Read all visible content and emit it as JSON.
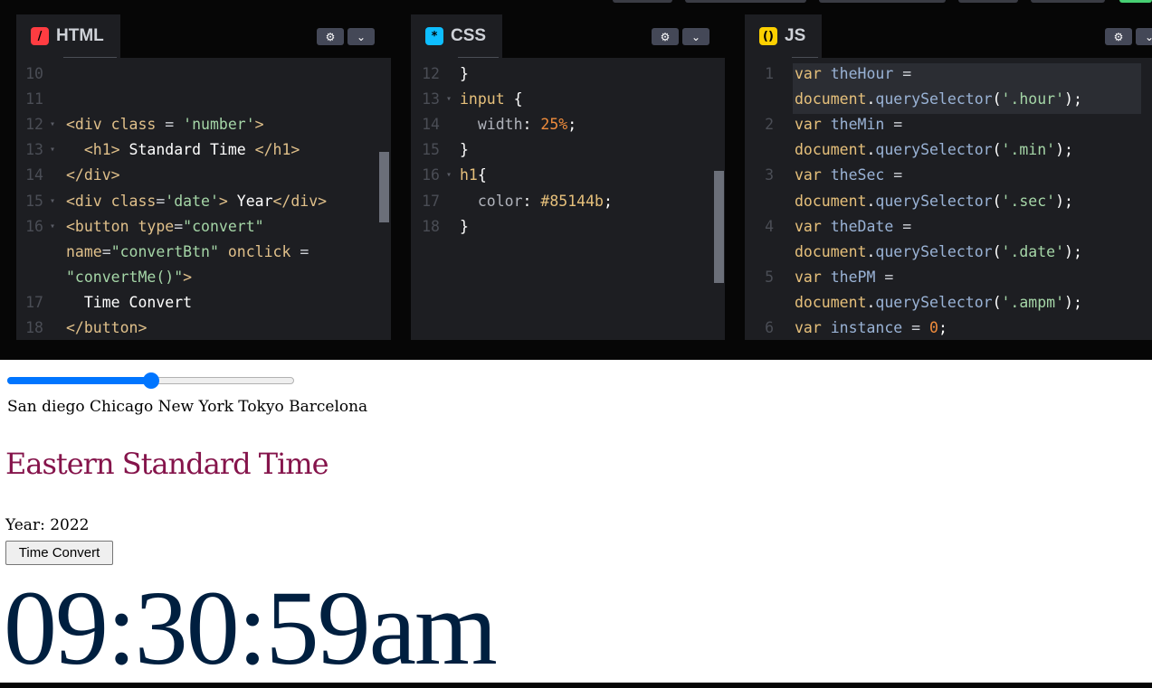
{
  "editors": {
    "html": {
      "title": "HTML",
      "badge": "/",
      "badge_color": "#ff3c41",
      "lines": [
        {
          "n": "10",
          "segs": []
        },
        {
          "n": "11",
          "segs": []
        },
        {
          "n": "12",
          "fold": true,
          "segs": [
            [
              "k-tag",
              "<div "
            ],
            [
              "k-attr",
              "class"
            ],
            [
              "k-op",
              " = "
            ],
            [
              "k-str",
              "'number'"
            ],
            [
              "k-tag",
              ">"
            ]
          ]
        },
        {
          "n": "13",
          "fold": true,
          "segs": [
            [
              "k-op",
              "  "
            ],
            [
              "k-tag",
              "<h1>"
            ],
            [
              "k-white",
              " Standard Time "
            ],
            [
              "k-tag",
              "</h1>"
            ]
          ]
        },
        {
          "n": "14",
          "segs": [
            [
              "k-tag",
              "</div>"
            ]
          ]
        },
        {
          "n": "15",
          "fold": true,
          "segs": [
            [
              "k-tag",
              "<div "
            ],
            [
              "k-attr",
              "class"
            ],
            [
              "k-op",
              "="
            ],
            [
              "k-str",
              "'date'"
            ],
            [
              "k-tag",
              ">"
            ],
            [
              "k-white",
              " Year"
            ],
            [
              "k-tag",
              "</div>"
            ]
          ]
        },
        {
          "n": "16",
          "fold": true,
          "segs": [
            [
              "k-tag",
              "<button "
            ],
            [
              "k-attr",
              "type"
            ],
            [
              "k-op",
              "="
            ],
            [
              "k-str",
              "\"convert\""
            ]
          ]
        },
        {
          "n": "",
          "segs": [
            [
              "k-attr",
              "name"
            ],
            [
              "k-op",
              "="
            ],
            [
              "k-str",
              "\"convertBtn\""
            ],
            [
              "k-op",
              " "
            ],
            [
              "k-attr",
              "onclick"
            ],
            [
              "k-op",
              " ="
            ]
          ]
        },
        {
          "n": "",
          "segs": [
            [
              "k-str",
              "\"convertMe()\""
            ],
            [
              "k-tag",
              ">"
            ]
          ]
        },
        {
          "n": "17",
          "segs": [
            [
              "k-white",
              "  Time Convert"
            ]
          ]
        },
        {
          "n": "18",
          "segs": [
            [
              "k-tag",
              "</button>"
            ]
          ]
        }
      ]
    },
    "css": {
      "title": "CSS",
      "badge": "*",
      "badge_color": "#0ebeff",
      "lines": [
        {
          "n": "12",
          "segs": [
            [
              "k-white",
              "}"
            ]
          ]
        },
        {
          "n": "13",
          "fold": true,
          "segs": [
            [
              "k-kw",
              "input"
            ],
            [
              "k-white",
              " {"
            ]
          ]
        },
        {
          "n": "14",
          "segs": [
            [
              "k-op",
              "  "
            ],
            [
              "k-prop",
              "width"
            ],
            [
              "k-white",
              ": "
            ],
            [
              "k-num",
              "25%"
            ],
            [
              "k-white",
              ";"
            ]
          ]
        },
        {
          "n": "15",
          "segs": [
            [
              "k-white",
              "}"
            ]
          ]
        },
        {
          "n": "16",
          "fold": true,
          "segs": [
            [
              "k-kw",
              "h1"
            ],
            [
              "k-white",
              "{"
            ]
          ]
        },
        {
          "n": "17",
          "segs": [
            [
              "k-op",
              "  "
            ],
            [
              "k-prop",
              "color"
            ],
            [
              "k-white",
              ": "
            ],
            [
              "k-kw",
              "#85144b"
            ],
            [
              "k-white",
              ";"
            ]
          ]
        },
        {
          "n": "18",
          "segs": [
            [
              "k-white",
              "}"
            ]
          ]
        }
      ]
    },
    "js": {
      "title": "JS",
      "badge": "()",
      "badge_color": "#fcd000",
      "lines": [
        {
          "n": "1",
          "segs": [
            [
              "k-kw",
              "var "
            ],
            [
              "k-var",
              "theHour"
            ],
            [
              "k-op",
              " ="
            ]
          ]
        },
        {
          "n": "",
          "segs": [
            [
              "k-kw",
              "document"
            ],
            [
              "k-white",
              "."
            ],
            [
              "k-fn",
              "querySelector"
            ],
            [
              "k-white",
              "("
            ],
            [
              "k-str",
              "'.hour'"
            ],
            [
              "k-white",
              ");"
            ]
          ]
        },
        {
          "n": "2",
          "segs": [
            [
              "k-kw",
              "var "
            ],
            [
              "k-var",
              "theMin"
            ],
            [
              "k-op",
              " ="
            ]
          ]
        },
        {
          "n": "",
          "segs": [
            [
              "k-kw",
              "document"
            ],
            [
              "k-white",
              "."
            ],
            [
              "k-fn",
              "querySelector"
            ],
            [
              "k-white",
              "("
            ],
            [
              "k-str",
              "'.min'"
            ],
            [
              "k-white",
              ");"
            ]
          ]
        },
        {
          "n": "3",
          "segs": [
            [
              "k-kw",
              "var "
            ],
            [
              "k-var",
              "theSec"
            ],
            [
              "k-op",
              " ="
            ]
          ]
        },
        {
          "n": "",
          "segs": [
            [
              "k-kw",
              "document"
            ],
            [
              "k-white",
              "."
            ],
            [
              "k-fn",
              "querySelector"
            ],
            [
              "k-white",
              "("
            ],
            [
              "k-str",
              "'.sec'"
            ],
            [
              "k-white",
              ");"
            ]
          ]
        },
        {
          "n": "4",
          "segs": [
            [
              "k-kw",
              "var "
            ],
            [
              "k-var",
              "theDate"
            ],
            [
              "k-op",
              " ="
            ]
          ]
        },
        {
          "n": "",
          "segs": [
            [
              "k-kw",
              "document"
            ],
            [
              "k-white",
              "."
            ],
            [
              "k-fn",
              "querySelector"
            ],
            [
              "k-white",
              "("
            ],
            [
              "k-str",
              "'.date'"
            ],
            [
              "k-white",
              ");"
            ]
          ]
        },
        {
          "n": "5",
          "segs": [
            [
              "k-kw",
              "var "
            ],
            [
              "k-var",
              "thePM"
            ],
            [
              "k-op",
              " ="
            ]
          ]
        },
        {
          "n": "",
          "segs": [
            [
              "k-kw",
              "document"
            ],
            [
              "k-white",
              "."
            ],
            [
              "k-fn",
              "querySelector"
            ],
            [
              "k-white",
              "("
            ],
            [
              "k-str",
              "'.ampm'"
            ],
            [
              "k-white",
              ");"
            ]
          ]
        },
        {
          "n": "6",
          "segs": [
            [
              "k-kw",
              "var "
            ],
            [
              "k-var",
              "instance"
            ],
            [
              "k-op",
              " = "
            ],
            [
              "k-num",
              "0"
            ],
            [
              "k-white",
              ";"
            ]
          ]
        }
      ]
    },
    "settings_icon": "gear-icon",
    "collapse_icon": "chevron-down-icon"
  },
  "preview": {
    "slider_value": 0.5,
    "cities": "San diego Chicago New York Tokyo Barcelona",
    "zone_heading": "Eastern Standard Time",
    "year": "Year: 2022",
    "convert_label": "Time Convert",
    "clock": "09:30:59am",
    "colors": {
      "heading": "#85144b",
      "clock": "#001f3f",
      "slider": "#0075ff"
    }
  }
}
